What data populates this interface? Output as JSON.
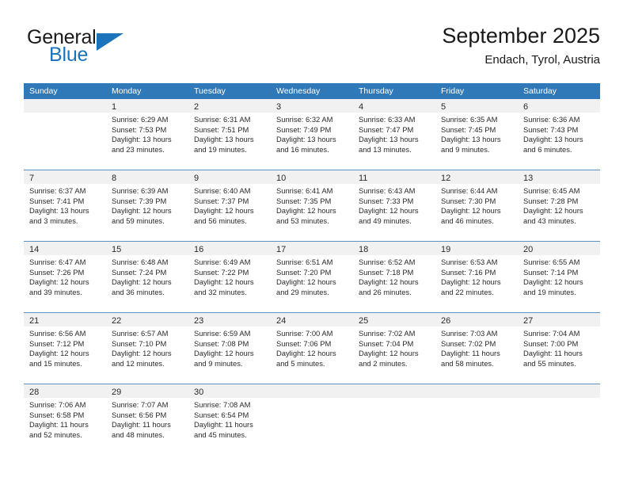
{
  "brand": {
    "name_top": "General",
    "name_bottom": "Blue",
    "flag_icon": "triangle-flag-icon"
  },
  "header": {
    "title": "September 2025",
    "subtitle": "Endach, Tyrol, Austria"
  },
  "colors": {
    "header_blue": "#3079b8",
    "row_divider_blue": "#5d93c4",
    "day_band_gray": "#f1f1f1",
    "brand_blue": "#1b74bb",
    "text": "#2a2a2a"
  },
  "weekdays": [
    "Sunday",
    "Monday",
    "Tuesday",
    "Wednesday",
    "Thursday",
    "Friday",
    "Saturday"
  ],
  "weeks": [
    [
      {
        "day": "",
        "lines": []
      },
      {
        "day": "1",
        "lines": [
          "Sunrise: 6:29 AM",
          "Sunset: 7:53 PM",
          "Daylight: 13 hours",
          "and 23 minutes."
        ]
      },
      {
        "day": "2",
        "lines": [
          "Sunrise: 6:31 AM",
          "Sunset: 7:51 PM",
          "Daylight: 13 hours",
          "and 19 minutes."
        ]
      },
      {
        "day": "3",
        "lines": [
          "Sunrise: 6:32 AM",
          "Sunset: 7:49 PM",
          "Daylight: 13 hours",
          "and 16 minutes."
        ]
      },
      {
        "day": "4",
        "lines": [
          "Sunrise: 6:33 AM",
          "Sunset: 7:47 PM",
          "Daylight: 13 hours",
          "and 13 minutes."
        ]
      },
      {
        "day": "5",
        "lines": [
          "Sunrise: 6:35 AM",
          "Sunset: 7:45 PM",
          "Daylight: 13 hours",
          "and 9 minutes."
        ]
      },
      {
        "day": "6",
        "lines": [
          "Sunrise: 6:36 AM",
          "Sunset: 7:43 PM",
          "Daylight: 13 hours",
          "and 6 minutes."
        ]
      }
    ],
    [
      {
        "day": "7",
        "lines": [
          "Sunrise: 6:37 AM",
          "Sunset: 7:41 PM",
          "Daylight: 13 hours",
          "and 3 minutes."
        ]
      },
      {
        "day": "8",
        "lines": [
          "Sunrise: 6:39 AM",
          "Sunset: 7:39 PM",
          "Daylight: 12 hours",
          "and 59 minutes."
        ]
      },
      {
        "day": "9",
        "lines": [
          "Sunrise: 6:40 AM",
          "Sunset: 7:37 PM",
          "Daylight: 12 hours",
          "and 56 minutes."
        ]
      },
      {
        "day": "10",
        "lines": [
          "Sunrise: 6:41 AM",
          "Sunset: 7:35 PM",
          "Daylight: 12 hours",
          "and 53 minutes."
        ]
      },
      {
        "day": "11",
        "lines": [
          "Sunrise: 6:43 AM",
          "Sunset: 7:33 PM",
          "Daylight: 12 hours",
          "and 49 minutes."
        ]
      },
      {
        "day": "12",
        "lines": [
          "Sunrise: 6:44 AM",
          "Sunset: 7:30 PM",
          "Daylight: 12 hours",
          "and 46 minutes."
        ]
      },
      {
        "day": "13",
        "lines": [
          "Sunrise: 6:45 AM",
          "Sunset: 7:28 PM",
          "Daylight: 12 hours",
          "and 43 minutes."
        ]
      }
    ],
    [
      {
        "day": "14",
        "lines": [
          "Sunrise: 6:47 AM",
          "Sunset: 7:26 PM",
          "Daylight: 12 hours",
          "and 39 minutes."
        ]
      },
      {
        "day": "15",
        "lines": [
          "Sunrise: 6:48 AM",
          "Sunset: 7:24 PM",
          "Daylight: 12 hours",
          "and 36 minutes."
        ]
      },
      {
        "day": "16",
        "lines": [
          "Sunrise: 6:49 AM",
          "Sunset: 7:22 PM",
          "Daylight: 12 hours",
          "and 32 minutes."
        ]
      },
      {
        "day": "17",
        "lines": [
          "Sunrise: 6:51 AM",
          "Sunset: 7:20 PM",
          "Daylight: 12 hours",
          "and 29 minutes."
        ]
      },
      {
        "day": "18",
        "lines": [
          "Sunrise: 6:52 AM",
          "Sunset: 7:18 PM",
          "Daylight: 12 hours",
          "and 26 minutes."
        ]
      },
      {
        "day": "19",
        "lines": [
          "Sunrise: 6:53 AM",
          "Sunset: 7:16 PM",
          "Daylight: 12 hours",
          "and 22 minutes."
        ]
      },
      {
        "day": "20",
        "lines": [
          "Sunrise: 6:55 AM",
          "Sunset: 7:14 PM",
          "Daylight: 12 hours",
          "and 19 minutes."
        ]
      }
    ],
    [
      {
        "day": "21",
        "lines": [
          "Sunrise: 6:56 AM",
          "Sunset: 7:12 PM",
          "Daylight: 12 hours",
          "and 15 minutes."
        ]
      },
      {
        "day": "22",
        "lines": [
          "Sunrise: 6:57 AM",
          "Sunset: 7:10 PM",
          "Daylight: 12 hours",
          "and 12 minutes."
        ]
      },
      {
        "day": "23",
        "lines": [
          "Sunrise: 6:59 AM",
          "Sunset: 7:08 PM",
          "Daylight: 12 hours",
          "and 9 minutes."
        ]
      },
      {
        "day": "24",
        "lines": [
          "Sunrise: 7:00 AM",
          "Sunset: 7:06 PM",
          "Daylight: 12 hours",
          "and 5 minutes."
        ]
      },
      {
        "day": "25",
        "lines": [
          "Sunrise: 7:02 AM",
          "Sunset: 7:04 PM",
          "Daylight: 12 hours",
          "and 2 minutes."
        ]
      },
      {
        "day": "26",
        "lines": [
          "Sunrise: 7:03 AM",
          "Sunset: 7:02 PM",
          "Daylight: 11 hours",
          "and 58 minutes."
        ]
      },
      {
        "day": "27",
        "lines": [
          "Sunrise: 7:04 AM",
          "Sunset: 7:00 PM",
          "Daylight: 11 hours",
          "and 55 minutes."
        ]
      }
    ],
    [
      {
        "day": "28",
        "lines": [
          "Sunrise: 7:06 AM",
          "Sunset: 6:58 PM",
          "Daylight: 11 hours",
          "and 52 minutes."
        ]
      },
      {
        "day": "29",
        "lines": [
          "Sunrise: 7:07 AM",
          "Sunset: 6:56 PM",
          "Daylight: 11 hours",
          "and 48 minutes."
        ]
      },
      {
        "day": "30",
        "lines": [
          "Sunrise: 7:08 AM",
          "Sunset: 6:54 PM",
          "Daylight: 11 hours",
          "and 45 minutes."
        ]
      },
      {
        "day": "",
        "lines": []
      },
      {
        "day": "",
        "lines": []
      },
      {
        "day": "",
        "lines": []
      },
      {
        "day": "",
        "lines": []
      }
    ]
  ]
}
